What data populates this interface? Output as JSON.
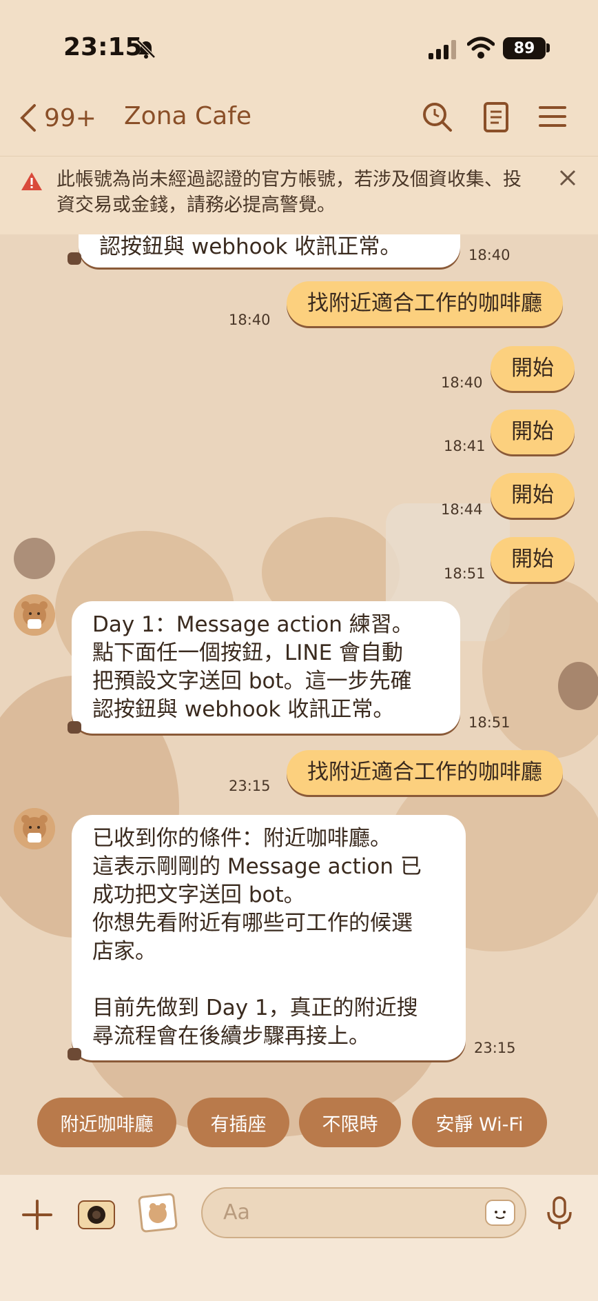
{
  "status": {
    "time": "23:15",
    "battery": "89"
  },
  "header": {
    "back_count": "99+",
    "title": "Zona Cafe"
  },
  "warning": {
    "text": "此帳號為尚未經過認證的官方帳號，若涉及個資收集、投資交易或金錢，請務必提高警覺。"
  },
  "messages": {
    "m0": {
      "text": "認按鈕與 webhook 收訊正常。",
      "time": "18:40"
    },
    "m1": {
      "text": "找附近適合工作的咖啡廳",
      "time": "18:40"
    },
    "m2": {
      "text": "開始",
      "time": "18:40"
    },
    "m3": {
      "text": "開始",
      "time": "18:41"
    },
    "m4": {
      "text": "開始",
      "time": "18:44"
    },
    "m5": {
      "text": "開始",
      "time": "18:51"
    },
    "m6": {
      "lines": [
        "Day 1：Message action 練習。",
        "點下面任一個按鈕，LINE 會自動",
        "把預設文字送回 bot。這一步先確",
        "認按鈕與 webhook 收訊正常。"
      ],
      "time": "18:51"
    },
    "m7": {
      "text": "找附近適合工作的咖啡廳",
      "time": "23:15"
    },
    "m8": {
      "lines": [
        "已收到你的條件：附近咖啡廳。",
        "這表示剛剛的 Message action 已",
        "成功把文字送回 bot。",
        "你想先看附近有哪些可工作的候選",
        "店家。",
        "",
        "目前先做到 Day 1，真正的附近搜",
        "尋流程會在後續步驟再接上。"
      ],
      "time": "23:15"
    }
  },
  "quick_replies": [
    "附近咖啡廳",
    "有插座",
    "不限時",
    "安靜 Wi-Fi"
  ],
  "input": {
    "placeholder": "Aa"
  },
  "colors": {
    "accent": "#8a4f28",
    "outgoing": "#fcd07e",
    "quick_reply": "#b97a4b",
    "background": "#ead5bd"
  }
}
